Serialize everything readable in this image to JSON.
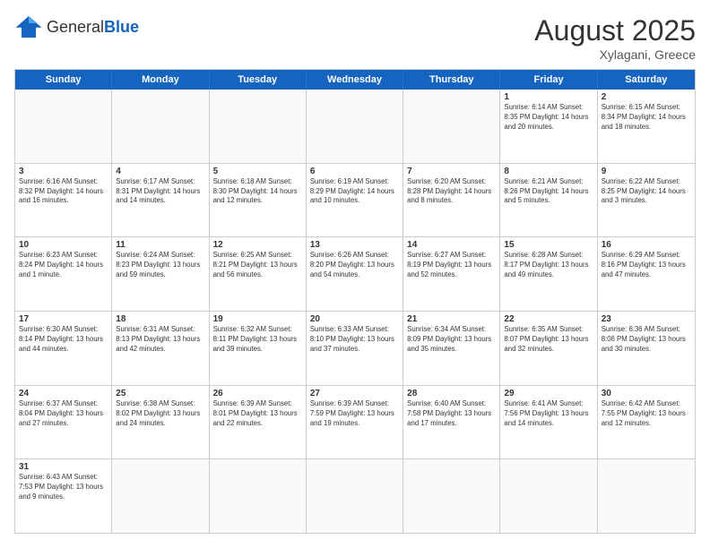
{
  "header": {
    "logo_general": "General",
    "logo_blue": "Blue",
    "title": "August 2025",
    "subtitle": "Xylagani, Greece"
  },
  "weekdays": [
    "Sunday",
    "Monday",
    "Tuesday",
    "Wednesday",
    "Thursday",
    "Friday",
    "Saturday"
  ],
  "weeks": [
    [
      {
        "day": "",
        "info": ""
      },
      {
        "day": "",
        "info": ""
      },
      {
        "day": "",
        "info": ""
      },
      {
        "day": "",
        "info": ""
      },
      {
        "day": "",
        "info": ""
      },
      {
        "day": "1",
        "info": "Sunrise: 6:14 AM\nSunset: 8:35 PM\nDaylight: 14 hours and 20 minutes."
      },
      {
        "day": "2",
        "info": "Sunrise: 6:15 AM\nSunset: 8:34 PM\nDaylight: 14 hours and 18 minutes."
      }
    ],
    [
      {
        "day": "3",
        "info": "Sunrise: 6:16 AM\nSunset: 8:32 PM\nDaylight: 14 hours and 16 minutes."
      },
      {
        "day": "4",
        "info": "Sunrise: 6:17 AM\nSunset: 8:31 PM\nDaylight: 14 hours and 14 minutes."
      },
      {
        "day": "5",
        "info": "Sunrise: 6:18 AM\nSunset: 8:30 PM\nDaylight: 14 hours and 12 minutes."
      },
      {
        "day": "6",
        "info": "Sunrise: 6:19 AM\nSunset: 8:29 PM\nDaylight: 14 hours and 10 minutes."
      },
      {
        "day": "7",
        "info": "Sunrise: 6:20 AM\nSunset: 8:28 PM\nDaylight: 14 hours and 8 minutes."
      },
      {
        "day": "8",
        "info": "Sunrise: 6:21 AM\nSunset: 8:26 PM\nDaylight: 14 hours and 5 minutes."
      },
      {
        "day": "9",
        "info": "Sunrise: 6:22 AM\nSunset: 8:25 PM\nDaylight: 14 hours and 3 minutes."
      }
    ],
    [
      {
        "day": "10",
        "info": "Sunrise: 6:23 AM\nSunset: 8:24 PM\nDaylight: 14 hours and 1 minute."
      },
      {
        "day": "11",
        "info": "Sunrise: 6:24 AM\nSunset: 8:23 PM\nDaylight: 13 hours and 59 minutes."
      },
      {
        "day": "12",
        "info": "Sunrise: 6:25 AM\nSunset: 8:21 PM\nDaylight: 13 hours and 56 minutes."
      },
      {
        "day": "13",
        "info": "Sunrise: 6:26 AM\nSunset: 8:20 PM\nDaylight: 13 hours and 54 minutes."
      },
      {
        "day": "14",
        "info": "Sunrise: 6:27 AM\nSunset: 8:19 PM\nDaylight: 13 hours and 52 minutes."
      },
      {
        "day": "15",
        "info": "Sunrise: 6:28 AM\nSunset: 8:17 PM\nDaylight: 13 hours and 49 minutes."
      },
      {
        "day": "16",
        "info": "Sunrise: 6:29 AM\nSunset: 8:16 PM\nDaylight: 13 hours and 47 minutes."
      }
    ],
    [
      {
        "day": "17",
        "info": "Sunrise: 6:30 AM\nSunset: 8:14 PM\nDaylight: 13 hours and 44 minutes."
      },
      {
        "day": "18",
        "info": "Sunrise: 6:31 AM\nSunset: 8:13 PM\nDaylight: 13 hours and 42 minutes."
      },
      {
        "day": "19",
        "info": "Sunrise: 6:32 AM\nSunset: 8:11 PM\nDaylight: 13 hours and 39 minutes."
      },
      {
        "day": "20",
        "info": "Sunrise: 6:33 AM\nSunset: 8:10 PM\nDaylight: 13 hours and 37 minutes."
      },
      {
        "day": "21",
        "info": "Sunrise: 6:34 AM\nSunset: 8:09 PM\nDaylight: 13 hours and 35 minutes."
      },
      {
        "day": "22",
        "info": "Sunrise: 6:35 AM\nSunset: 8:07 PM\nDaylight: 13 hours and 32 minutes."
      },
      {
        "day": "23",
        "info": "Sunrise: 6:36 AM\nSunset: 8:06 PM\nDaylight: 13 hours and 30 minutes."
      }
    ],
    [
      {
        "day": "24",
        "info": "Sunrise: 6:37 AM\nSunset: 8:04 PM\nDaylight: 13 hours and 27 minutes."
      },
      {
        "day": "25",
        "info": "Sunrise: 6:38 AM\nSunset: 8:02 PM\nDaylight: 13 hours and 24 minutes."
      },
      {
        "day": "26",
        "info": "Sunrise: 6:39 AM\nSunset: 8:01 PM\nDaylight: 13 hours and 22 minutes."
      },
      {
        "day": "27",
        "info": "Sunrise: 6:39 AM\nSunset: 7:59 PM\nDaylight: 13 hours and 19 minutes."
      },
      {
        "day": "28",
        "info": "Sunrise: 6:40 AM\nSunset: 7:58 PM\nDaylight: 13 hours and 17 minutes."
      },
      {
        "day": "29",
        "info": "Sunrise: 6:41 AM\nSunset: 7:56 PM\nDaylight: 13 hours and 14 minutes."
      },
      {
        "day": "30",
        "info": "Sunrise: 6:42 AM\nSunset: 7:55 PM\nDaylight: 13 hours and 12 minutes."
      }
    ],
    [
      {
        "day": "31",
        "info": "Sunrise: 6:43 AM\nSunset: 7:53 PM\nDaylight: 13 hours and 9 minutes."
      },
      {
        "day": "",
        "info": ""
      },
      {
        "day": "",
        "info": ""
      },
      {
        "day": "",
        "info": ""
      },
      {
        "day": "",
        "info": ""
      },
      {
        "day": "",
        "info": ""
      },
      {
        "day": "",
        "info": ""
      }
    ]
  ]
}
